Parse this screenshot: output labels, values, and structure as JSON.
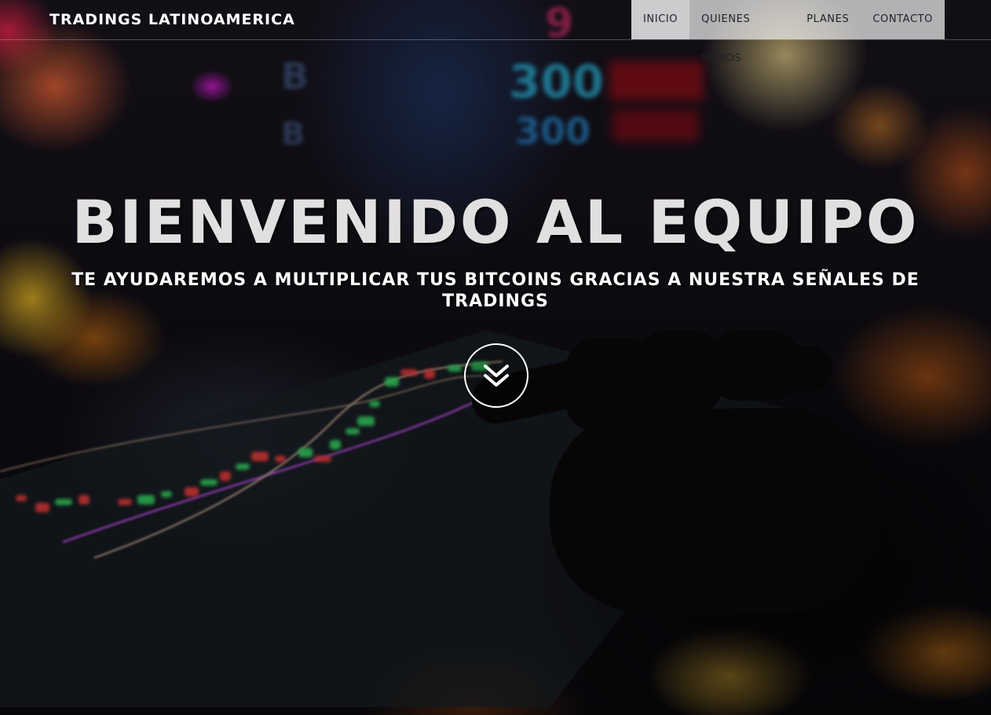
{
  "navbar": {
    "brand": "TRADINGS LATINOAMERICA",
    "items": [
      {
        "label": "INICIO",
        "active": true
      },
      {
        "label": "QUIENES SOMOS",
        "active": false
      },
      {
        "label": "PLANES",
        "active": false
      },
      {
        "label": "CONTACTO",
        "active": false
      }
    ]
  },
  "hero": {
    "title": "BIENVENIDO AL EQUIPO",
    "subtitle": "TE AYUDAREMOS A MULTIPLICAR TUS BITCOINS GRACIAS A NUESTRA SEÑALES DE TRADINGS",
    "scroll_icon": "double-chevron-down-icon"
  },
  "background": {
    "screen_numbers": [
      "300",
      "300",
      "9",
      "B",
      "B"
    ]
  },
  "colors": {
    "nav_background": "#f0f0f0",
    "nav_text": "#1f2326",
    "title_text": "#e2dfe0",
    "candle_up": "#39e36a",
    "candle_down": "#ff4040",
    "line_purple": "#b04bd8",
    "line_tan": "#d9b89a"
  }
}
